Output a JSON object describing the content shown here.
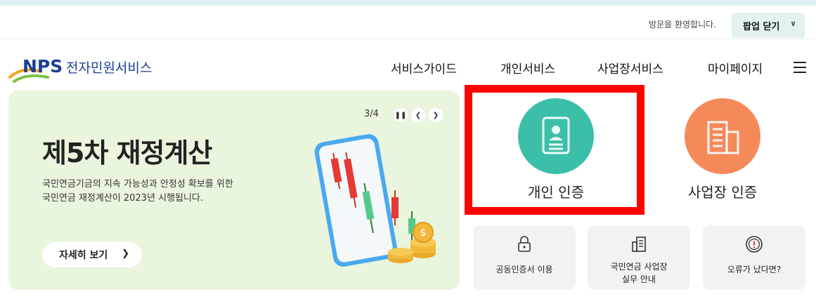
{
  "topbar": {
    "welcome": "방문을 환영합니다.",
    "popup_close": "팝업 닫기"
  },
  "logo": {
    "abbr": "NPS",
    "name": "전자민원서비스"
  },
  "gnb": {
    "items": [
      "서비스가이드",
      "개인서비스",
      "사업장서비스",
      "마이페이지"
    ]
  },
  "banner": {
    "counter": "3/4",
    "title": "제5차 재정계산",
    "desc_line1": "국민연금기금의 지속 가능성과 안정성 확보를 위한",
    "desc_line2": "국민연금 재정계산이 2023년 시행됩니다.",
    "detail_label": "자세히 보기"
  },
  "certs": {
    "personal": {
      "label": "개인 인증",
      "color": "#3bbfa8"
    },
    "business": {
      "label": "사업장 인증",
      "color": "#f5895a"
    }
  },
  "highlight_color": "#ff0000",
  "quick_links": [
    {
      "label": "공동인증서 이용",
      "icon": "lock-icon"
    },
    {
      "label_line1": "국민연금 사업장",
      "label_line2": "실무 안내",
      "icon": "building-doc-icon"
    },
    {
      "label": "오류가 났다면?",
      "icon": "alert-icon"
    }
  ]
}
